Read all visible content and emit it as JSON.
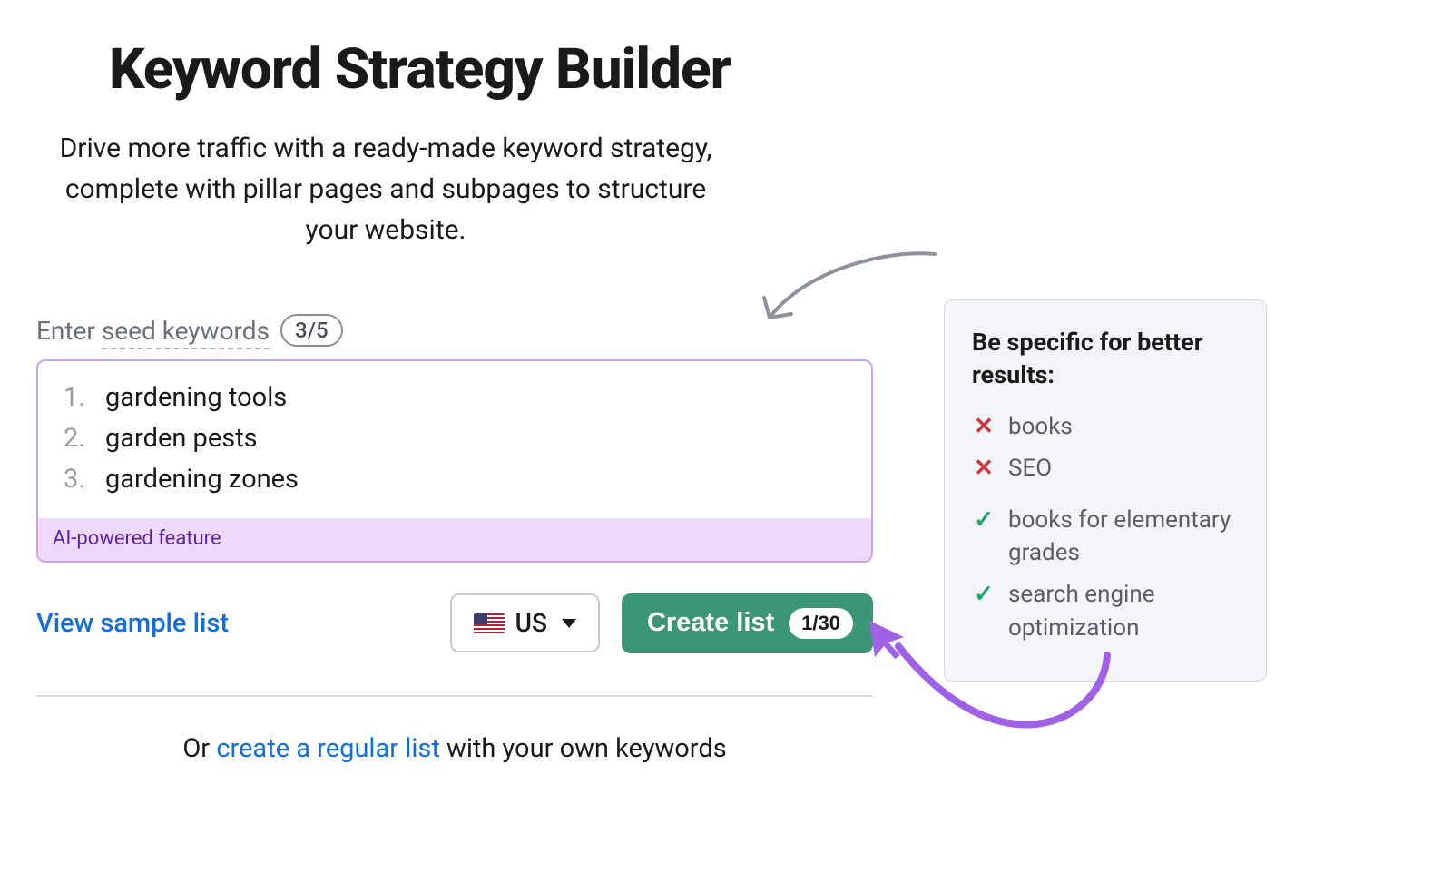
{
  "title": "Keyword Strategy Builder",
  "subtitle": "Drive more traffic with a ready-made keyword strategy, complete with pillar pages and subpages to structure your website.",
  "seed": {
    "label_pre": "Enter ",
    "label_dotted": "seed keywords",
    "counter": "3/5",
    "items": [
      "gardening tools",
      "garden pests",
      "gardening zones"
    ],
    "ai_footer": "AI-powered feature"
  },
  "controls": {
    "view_sample": "View sample list",
    "country_label": "US",
    "create_label": "Create list",
    "create_badge": "1/30"
  },
  "alt": {
    "pre": "Or ",
    "link": "create a regular list",
    "post": " with your own keywords"
  },
  "tip": {
    "title": "Be specific for better results:",
    "bad": [
      "books",
      "SEO"
    ],
    "good": [
      "books for elementary grades",
      "search engine optimization"
    ]
  }
}
